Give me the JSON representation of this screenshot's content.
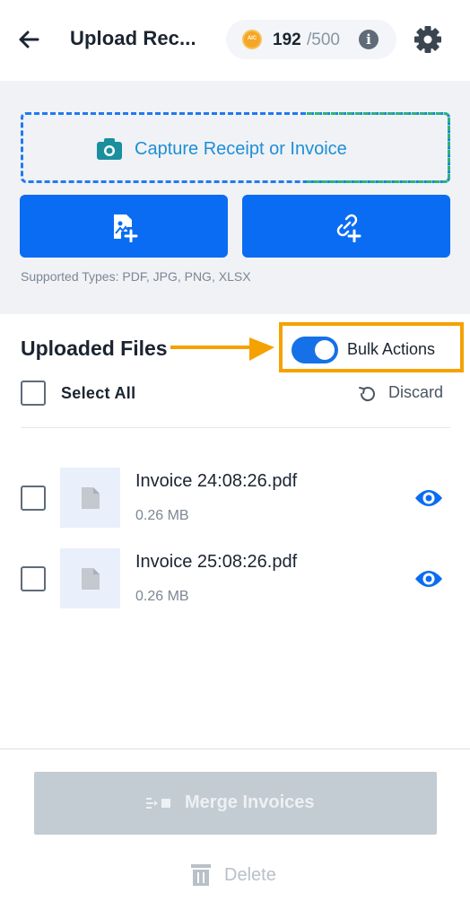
{
  "header": {
    "title": "Upload Rec...",
    "coin_label": "AIC",
    "credits_used": "192",
    "credits_total": "/500",
    "info_glyph": "i"
  },
  "upload": {
    "capture_label": "Capture Receipt or Invoice",
    "supported_types": "Supported Types: PDF, JPG, PNG, XLSX"
  },
  "files_section": {
    "title": "Uploaded Files",
    "bulk_actions_label": "Bulk Actions",
    "bulk_actions_on": true,
    "select_all_label": "Select All",
    "discard_label": "Discard"
  },
  "files": [
    {
      "name": "Invoice 24:08:26.pdf",
      "size": "0.26 MB"
    },
    {
      "name": "Invoice 25:08:26.pdf",
      "size": "0.26 MB"
    }
  ],
  "footer": {
    "merge_label": "Merge Invoices",
    "delete_label": "Delete"
  },
  "colors": {
    "primary": "#0a6cf2",
    "annotation": "#f5a100",
    "disabled": "#c3cbd3"
  }
}
